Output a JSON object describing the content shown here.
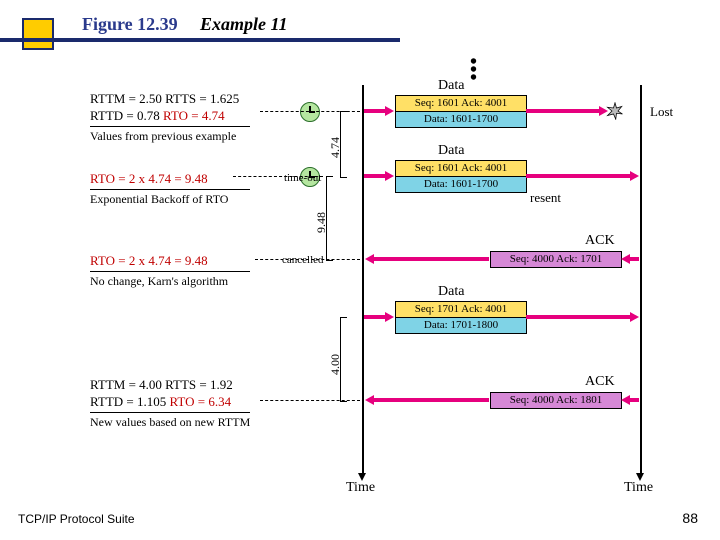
{
  "title": {
    "fig": "Figure 12.39",
    "example": "Example 11"
  },
  "footer": {
    "left": "TCP/IP Protocol Suite",
    "right": "88"
  },
  "timelines": {
    "left_bottom": "Time",
    "right_bottom": "Time"
  },
  "calc1": {
    "l1": "RTTM = 2.50 RTTS = 1.625",
    "l2a": "RTTD = 0.78 ",
    "l2b": "RTO = 4.74",
    "note": "Values from previous example"
  },
  "calc2": {
    "l1a": "RTO = 2 x 4.74 = 9.48",
    "note": "Exponential Backoff of RTO"
  },
  "calc3": {
    "l1a": "RTO = 2 x 4.74 = 9.48",
    "note": "No change, Karn's algorithm"
  },
  "calc4": {
    "l1": "RTTM = 4.00 RTTS = 1.92",
    "l2a": "RTTD = 1.105 ",
    "l2b": "RTO = 6.34",
    "note": "New values based on new RTTM"
  },
  "events": {
    "data1": {
      "label": "Data",
      "seq": "Seq: 1601  Ack: 4001",
      "data": "Data: 1601-1700",
      "status": "Lost"
    },
    "data2": {
      "label": "Data",
      "seq": "Seq: 1601  Ack: 4001",
      "data": "Data: 1601-1700",
      "status": "resent"
    },
    "ack1": {
      "label": "ACK",
      "seq": "Seq: 4000  Ack: 1701"
    },
    "data3": {
      "label": "Data",
      "seq": "Seq: 1701  Ack: 4001",
      "data": "Data: 1701-1800"
    },
    "ack2": {
      "label": "ACK",
      "seq": "Seq: 4000  Ack: 1801"
    }
  },
  "timers": {
    "t1": "4.74",
    "t2": "9.48",
    "t3": "4.00"
  },
  "misc": {
    "timeout": "time-out",
    "cancelled": "cancelled"
  }
}
